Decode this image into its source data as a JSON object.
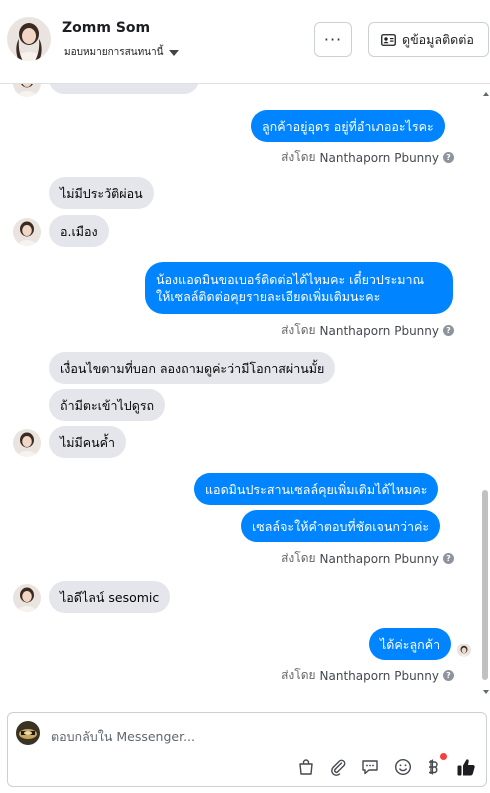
{
  "header": {
    "contact_name": "Zomm Som",
    "assign_label": "มอบหมายการสนทนานี้",
    "more_label": "···",
    "view_contact_label": "ดูข้อมูลติดต่อ"
  },
  "messages": [
    {
      "side": "out",
      "text": "ลูกค้าอยู่อุดร อยู่ที่อำเภออะไรคะ"
    },
    {
      "side": "meta",
      "prefix": "ส่งโดย",
      "sender": "Nanthaporn Pbunny"
    },
    {
      "side": "in",
      "text": "ไม่มีประวัติผ่อน"
    },
    {
      "side": "in",
      "text": "อ.เมือง"
    },
    {
      "side": "out",
      "lines": [
        "น้องแอดมินขอเบอร์ติดต่อได้ไหมคะ เดี๋ยวประมาณ",
        "ให้เซลล์ติดต่อคุยรายละเอียดเพิ่มเติมนะคะ"
      ]
    },
    {
      "side": "meta",
      "prefix": "ส่งโดย",
      "sender": "Nanthaporn Pbunny"
    },
    {
      "side": "in",
      "text": "เงื่อนไขตามที่บอก ลองถามดูค่ะว่ามีโอกาสผ่านมั้ย"
    },
    {
      "side": "in",
      "text": "ถ้ามีตะเข้าไปดูรถ"
    },
    {
      "side": "in",
      "text": "ไม่มีคนค้ำ"
    },
    {
      "side": "out",
      "text": "แอดมินประสานเซลล์คุยเพิ่มเติมได้ไหมคะ"
    },
    {
      "side": "out",
      "text": "เซลล์จะให้คำตอบที่ชัดเจนกว่าค่ะ"
    },
    {
      "side": "meta",
      "prefix": "ส่งโดย",
      "sender": "Nanthaporn Pbunny"
    },
    {
      "side": "in",
      "text": "ไอดีไลน์ sesomic"
    },
    {
      "side": "out",
      "text": "ได้ค่ะลูกค้า"
    },
    {
      "side": "meta",
      "prefix": "ส่งโดย",
      "sender": "Nanthaporn Pbunny"
    }
  ],
  "composer": {
    "placeholder": "ตอบกลับใน Messenger..."
  },
  "icons": {
    "more": "ellipsis-icon",
    "contact": "contact-card-icon",
    "composer_tools": [
      "shopping-bag-icon",
      "paperclip-icon",
      "saved-reply-icon",
      "emoji-icon",
      "baht-payment-icon",
      "thumbs-up-icon"
    ]
  },
  "colors": {
    "outgoing_bubble": "#0084ff",
    "incoming_bubble": "#e4e6eb",
    "like_icon": "#1c1e21",
    "notification_dot": "#fa3e3e"
  }
}
